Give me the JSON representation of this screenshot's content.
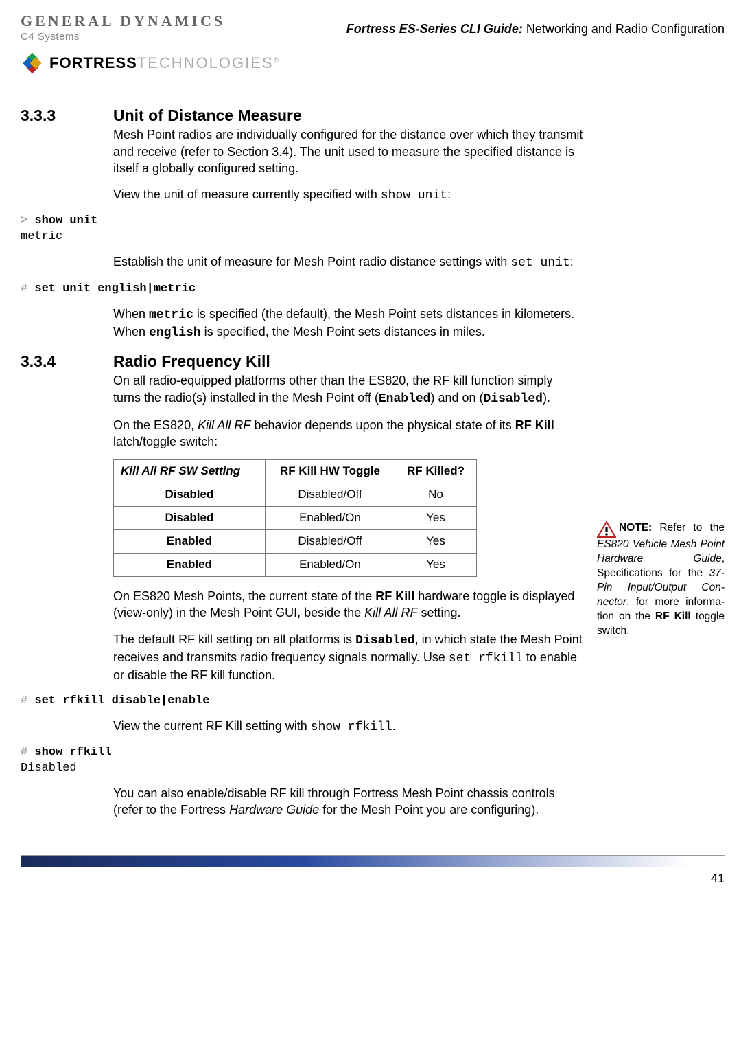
{
  "header": {
    "gd_top": "GENERAL DYNAMICS",
    "gd_sub": "C4 Systems",
    "title_italic": "Fortress ES-Series CLI Guide:",
    "title_plain": " Networking and Radio Configuration",
    "fortress_bold": "FORTRESS",
    "fortress_light": "TECHNOLOGIES"
  },
  "s333": {
    "num": "3.3.3",
    "title": "Unit of Distance Measure",
    "p1": "Mesh Point radios are individually configured for the distance over which they transmit and receive (refer to Section 3.4). The unit used to measure the specified distance is itself a globally configured setting.",
    "p2_a": "View the unit of measure currently specified with ",
    "p2_code": "show unit",
    "p2_b": ":",
    "cli1_prompt": "> ",
    "cli1_cmd": "show unit",
    "cli1_out": "metric",
    "p3_a": "Establish the unit of measure for Mesh Point radio distance settings with ",
    "p3_code": "set unit",
    "p3_b": ":",
    "cli2_prompt": "# ",
    "cli2_cmd": "set unit english|metric",
    "p4_a": "When ",
    "p4_c1": "metric",
    "p4_b": " is specified (the default), the Mesh Point sets distances in kilometers. When ",
    "p4_c2": "english",
    "p4_c": " is specified, the Mesh Point sets distances in miles."
  },
  "s334": {
    "num": "3.3.4",
    "title": "Radio Frequency Kill",
    "p1_a": "On all radio-equipped platforms other than the ES820, the RF kill function simply turns the radio(s) installed in the Mesh Point off (",
    "p1_c1": "Enabled",
    "p1_b": ") and on (",
    "p1_c2": "Disabled",
    "p1_c": ").",
    "p2_a": "On the ES820, ",
    "p2_i": "Kill All RF",
    "p2_b": " behavior depends upon the physical state of its ",
    "p2_bold": "RF Kill",
    "p2_c": " latch/toggle switch:",
    "table": {
      "h1_i": "Kill All RF",
      "h1_r": " SW Setting",
      "h2": "RF Kill HW Toggle",
      "h3": "RF Killed?",
      "rows": [
        {
          "c1": "Disabled",
          "c2": "Disabled/Off",
          "c3": "No"
        },
        {
          "c1": "Disabled",
          "c2": "Enabled/On",
          "c3": "Yes"
        },
        {
          "c1": "Enabled",
          "c2": "Disabled/Off",
          "c3": "Yes"
        },
        {
          "c1": "Enabled",
          "c2": "Enabled/On",
          "c3": "Yes"
        }
      ]
    },
    "p3_a": "On ES820 Mesh Points, the current state of the ",
    "p3_bold": "RF Kill",
    "p3_b": " hardware toggle is displayed (view-only) in the Mesh Point GUI, beside the ",
    "p3_i": "Kill All RF",
    "p3_c": " setting.",
    "p4_a": "The default RF kill setting on all platforms is ",
    "p4_c1": "Disabled",
    "p4_b": ", in which state the Mesh Point receives and transmits radio frequency signals normally. Use ",
    "p4_c2": "set rfkill",
    "p4_c": " to enable or disable the RF kill function.",
    "cli3_prompt": "# ",
    "cli3_cmd": "set rfkill disable|enable",
    "p5_a": "View the current RF Kill setting with ",
    "p5_c": "show rfkill",
    "p5_b": ".",
    "cli4_prompt": "# ",
    "cli4_cmd": "show rfkill",
    "cli4_out": "Disabled",
    "p6_a": "You can also enable/disable RF kill through Fortress Mesh Point chassis controls (refer to the Fortress ",
    "p6_i": "Hardware Guide",
    "p6_b": " for the Mesh Point you are configuring)."
  },
  "sidenote": {
    "label": "NOTE:",
    "t1": " Refer to the ",
    "i1": "ES820 Vehicle Mesh Point Hardware Guide",
    "t2": ", Specifications for the ",
    "i2": "37-Pin Input/Output Con­nector",
    "t3": ", for more informa­tion on the ",
    "b1": "RF Kill",
    "t4": " toggle switch."
  },
  "page_num": "41"
}
